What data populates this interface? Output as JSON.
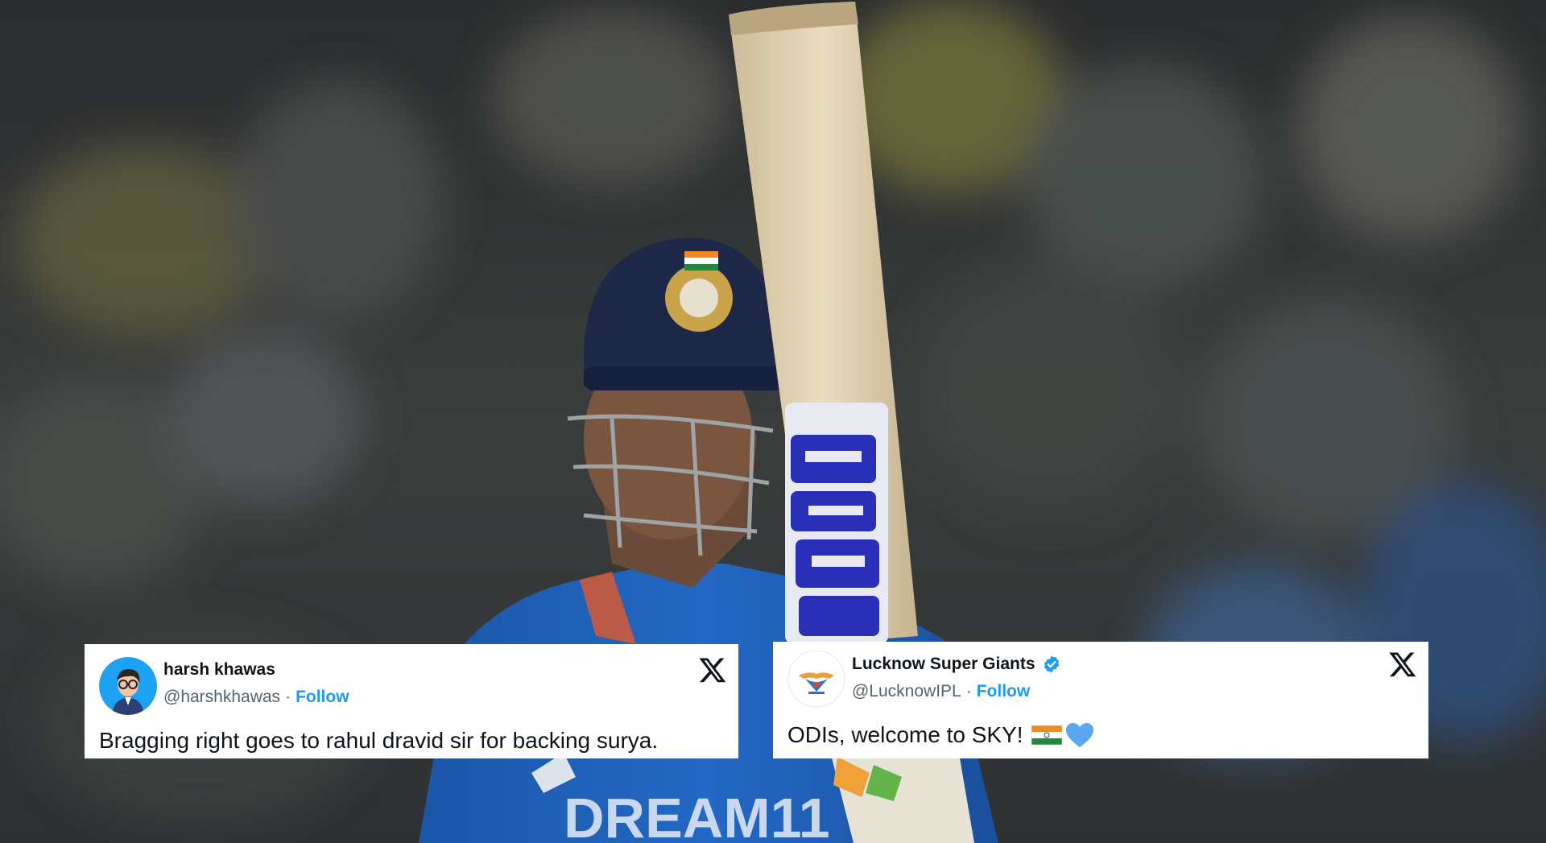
{
  "tweets": [
    {
      "author_name": "harsh khawas",
      "handle": "@harshkhawas",
      "separator": "·",
      "follow_label": "Follow",
      "text": "Bragging right goes to rahul dravid sir for backing surya.",
      "platform_icon": "x-logo-icon"
    },
    {
      "author_name": "Lucknow Super Giants",
      "handle": "@LucknowIPL",
      "separator": "·",
      "follow_label": "Follow",
      "text": "ODIs, welcome to SKY!",
      "emojis": [
        "india-flag-icon",
        "blue-heart-icon"
      ],
      "platform_icon": "x-logo-icon",
      "verified": true
    }
  ],
  "colors": {
    "follow_blue": "#1d9bf0",
    "text_primary": "#0f1419",
    "text_secondary": "#536471",
    "jersey_blue": "#1f5fb5",
    "bat_sticker_blue": "#2a2fb8"
  }
}
